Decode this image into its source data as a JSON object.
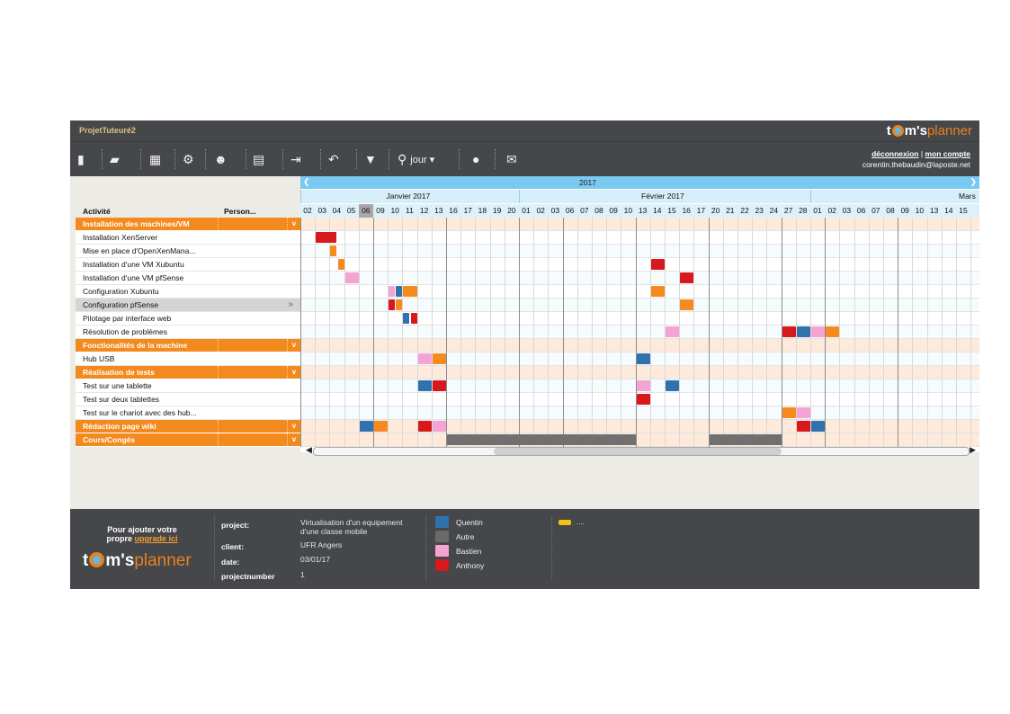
{
  "app": {
    "project_title": "ProjetTuteuré2",
    "brand_t": "t",
    "brand_m": "m's",
    "brand_planner": "planner"
  },
  "toolbar": {
    "buttons": [
      {
        "name": "new-file-icon",
        "glyph": "▮"
      },
      {
        "name": "open-folder-icon",
        "glyph": "▰"
      },
      {
        "name": "save-icon",
        "glyph": "▦"
      },
      {
        "name": "settings-icon",
        "glyph": "⚙"
      },
      {
        "name": "users-icon",
        "glyph": "☻"
      },
      {
        "name": "print-icon",
        "glyph": "▤"
      },
      {
        "name": "export-icon",
        "glyph": "⇥"
      },
      {
        "name": "undo-icon",
        "glyph": "↶"
      },
      {
        "name": "filter-icon",
        "glyph": "▼"
      },
      {
        "name": "zoom-icon",
        "glyph": "⚲"
      },
      {
        "name": "info-icon",
        "glyph": "●"
      },
      {
        "name": "mail-icon",
        "glyph": "✉"
      }
    ],
    "zoom_label": "jour ▾"
  },
  "account": {
    "logout": "déconnexion",
    "separator": "|",
    "my_account": "mon compte",
    "email": "corentin.thebaudin@laposte.net"
  },
  "tasklist": {
    "col_activity": "Activité",
    "col_person": "Person...",
    "rows": [
      {
        "type": "group",
        "label": "Installation des machines/VM"
      },
      {
        "type": "task",
        "label": "Installation XenServer"
      },
      {
        "type": "task",
        "label": "Mise en place d'OpenXenMana..."
      },
      {
        "type": "task",
        "label": "Installation d'une VM Xubuntu"
      },
      {
        "type": "task",
        "label": "Installation d'une VM pfSense"
      },
      {
        "type": "task",
        "label": "Configuration Xubuntu"
      },
      {
        "type": "task",
        "label": "Configuration pfSense",
        "selected": true
      },
      {
        "type": "task",
        "label": "Pilotage par interface web"
      },
      {
        "type": "task",
        "label": "Résolution de problèmes"
      },
      {
        "type": "group",
        "label": "Fonctionalités de la machine"
      },
      {
        "type": "task",
        "label": "Hub USB"
      },
      {
        "type": "group",
        "label": "Réalisation de tests"
      },
      {
        "type": "task",
        "label": "Test sur une tablette"
      },
      {
        "type": "task",
        "label": "Test sur deux tablettes"
      },
      {
        "type": "task",
        "label": "Test sur le chariot avec des hub..."
      },
      {
        "type": "group",
        "label": "Rédaction page wiki"
      },
      {
        "type": "group",
        "label": "Cours/Congés"
      }
    ]
  },
  "calendar": {
    "year": "2017",
    "months": [
      {
        "label": "Janvier 2017",
        "start": 0,
        "end": 15
      },
      {
        "label": "Février 2017",
        "start": 15,
        "end": 35
      },
      {
        "label": "Mars",
        "start": 35,
        "end": 46
      }
    ],
    "days": [
      "02",
      "03",
      "04",
      "05",
      "06",
      "09",
      "10",
      "11",
      "12",
      "13",
      "16",
      "17",
      "18",
      "19",
      "20",
      "01",
      "02",
      "03",
      "06",
      "07",
      "08",
      "09",
      "10",
      "13",
      "14",
      "15",
      "16",
      "17",
      "20",
      "21",
      "22",
      "23",
      "24",
      "27",
      "28",
      "01",
      "02",
      "03",
      "06",
      "07",
      "08",
      "09",
      "10",
      "13",
      "14",
      "15"
    ],
    "today_index": 4,
    "week_starts": [
      0,
      5,
      10,
      15,
      18,
      23,
      28,
      33,
      36,
      41
    ]
  },
  "people": {
    "Quentin": "#2f72ad",
    "Autre": "#6a6a6a",
    "Bastien": "#f4a3d2",
    "Anthony": "#d7181d",
    "Orange": "#f68a1e"
  },
  "assignments": [
    {
      "row": 1,
      "col": 1,
      "len": 1.5,
      "who": "Anthony"
    },
    {
      "row": 2,
      "col": 2,
      "len": 0.5,
      "who": "Orange"
    },
    {
      "row": 3,
      "col": 2.5,
      "len": 0.5,
      "who": "Orange"
    },
    {
      "row": 3,
      "col": 24,
      "len": 1,
      "who": "Anthony"
    },
    {
      "row": 4,
      "col": 3,
      "len": 1,
      "who": "Bastien"
    },
    {
      "row": 4,
      "col": 26,
      "len": 1,
      "who": "Anthony"
    },
    {
      "row": 5,
      "col": 6,
      "len": 0.5,
      "who": "Bastien"
    },
    {
      "row": 5,
      "col": 6.5,
      "len": 0.5,
      "who": "Quentin"
    },
    {
      "row": 5,
      "col": 7,
      "len": 1,
      "who": "Orange"
    },
    {
      "row": 5,
      "col": 24,
      "len": 1,
      "who": "Orange"
    },
    {
      "row": 6,
      "col": 6,
      "len": 0.5,
      "who": "Anthony"
    },
    {
      "row": 6,
      "col": 6.5,
      "len": 0.5,
      "who": "Orange"
    },
    {
      "row": 6,
      "col": 26,
      "len": 1,
      "who": "Orange"
    },
    {
      "row": 7,
      "col": 7,
      "len": 0.5,
      "who": "Quentin"
    },
    {
      "row": 7,
      "col": 7.5,
      "len": 0.5,
      "who": "Anthony"
    },
    {
      "row": 8,
      "col": 25,
      "len": 1,
      "who": "Bastien"
    },
    {
      "row": 8,
      "col": 33,
      "len": 1,
      "who": "Anthony"
    },
    {
      "row": 8,
      "col": 34,
      "len": 1,
      "who": "Quentin"
    },
    {
      "row": 8,
      "col": 35,
      "len": 1,
      "who": "Bastien"
    },
    {
      "row": 8,
      "col": 36,
      "len": 1,
      "who": "Orange"
    },
    {
      "row": 10,
      "col": 8,
      "len": 1,
      "who": "Bastien"
    },
    {
      "row": 10,
      "col": 9,
      "len": 1,
      "who": "Orange"
    },
    {
      "row": 10,
      "col": 23,
      "len": 1,
      "who": "Quentin"
    },
    {
      "row": 12,
      "col": 8,
      "len": 1,
      "who": "Quentin"
    },
    {
      "row": 12,
      "col": 9,
      "len": 1,
      "who": "Anthony"
    },
    {
      "row": 12,
      "col": 23,
      "len": 1,
      "who": "Bastien"
    },
    {
      "row": 12,
      "col": 25,
      "len": 1,
      "who": "Quentin"
    },
    {
      "row": 13,
      "col": 23,
      "len": 1,
      "who": "Anthony"
    },
    {
      "row": 14,
      "col": 33,
      "len": 1,
      "who": "Orange"
    },
    {
      "row": 14,
      "col": 34,
      "len": 1,
      "who": "Bastien"
    },
    {
      "row": 15,
      "col": 4,
      "len": 1,
      "who": "Quentin"
    },
    {
      "row": 15,
      "col": 5,
      "len": 1,
      "who": "Orange"
    },
    {
      "row": 15,
      "col": 8,
      "len": 1,
      "who": "Anthony"
    },
    {
      "row": 15,
      "col": 9,
      "len": 1,
      "who": "Bastien"
    },
    {
      "row": 15,
      "col": 34,
      "len": 1,
      "who": "Anthony"
    },
    {
      "row": 15,
      "col": 35,
      "len": 1,
      "who": "Quentin"
    }
  ],
  "holidays": [
    {
      "row": 16,
      "col": 10,
      "len": 13
    },
    {
      "row": 16,
      "col": 28,
      "len": 5
    }
  ],
  "footer": {
    "promo_line1": "Pour ajouter votre",
    "promo_line2_prefix": "propre ",
    "promo_link": "upgrade ici",
    "project_label": "project:",
    "project_value_1": "Virtualisation d'un equipement",
    "project_value_2": "d'une classe mobile",
    "client_label": "client:",
    "client_value": "UFR Angers",
    "date_label": "date:",
    "date_value": "03/01/17",
    "number_label": "projectnumber",
    "number_value": "1",
    "legend": [
      {
        "name": "Quentin",
        "color": "#2f72ad"
      },
      {
        "name": "Autre",
        "color": "#6a6a6a"
      },
      {
        "name": "Bastien",
        "color": "#f4a3d2"
      },
      {
        "name": "Anthony",
        "color": "#d7181d"
      }
    ],
    "car_text": "....",
    "car_icon": "car-icon"
  }
}
